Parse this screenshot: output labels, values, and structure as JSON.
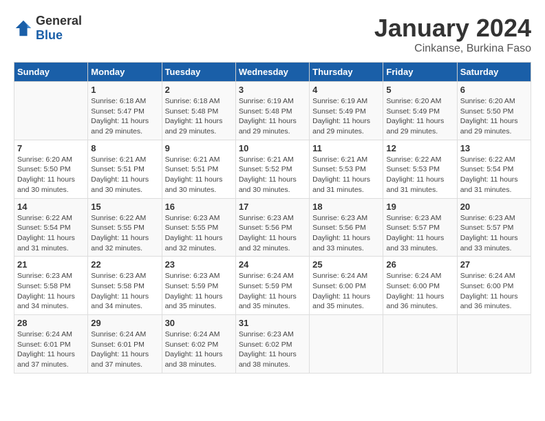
{
  "header": {
    "logo_general": "General",
    "logo_blue": "Blue",
    "month": "January 2024",
    "location": "Cinkanse, Burkina Faso"
  },
  "weekdays": [
    "Sunday",
    "Monday",
    "Tuesday",
    "Wednesday",
    "Thursday",
    "Friday",
    "Saturday"
  ],
  "weeks": [
    [
      {
        "day": "",
        "sunrise": "",
        "sunset": "",
        "daylight": ""
      },
      {
        "day": "1",
        "sunrise": "Sunrise: 6:18 AM",
        "sunset": "Sunset: 5:47 PM",
        "daylight": "Daylight: 11 hours and 29 minutes."
      },
      {
        "day": "2",
        "sunrise": "Sunrise: 6:18 AM",
        "sunset": "Sunset: 5:48 PM",
        "daylight": "Daylight: 11 hours and 29 minutes."
      },
      {
        "day": "3",
        "sunrise": "Sunrise: 6:19 AM",
        "sunset": "Sunset: 5:48 PM",
        "daylight": "Daylight: 11 hours and 29 minutes."
      },
      {
        "day": "4",
        "sunrise": "Sunrise: 6:19 AM",
        "sunset": "Sunset: 5:49 PM",
        "daylight": "Daylight: 11 hours and 29 minutes."
      },
      {
        "day": "5",
        "sunrise": "Sunrise: 6:20 AM",
        "sunset": "Sunset: 5:49 PM",
        "daylight": "Daylight: 11 hours and 29 minutes."
      },
      {
        "day": "6",
        "sunrise": "Sunrise: 6:20 AM",
        "sunset": "Sunset: 5:50 PM",
        "daylight": "Daylight: 11 hours and 29 minutes."
      }
    ],
    [
      {
        "day": "7",
        "sunrise": "Sunrise: 6:20 AM",
        "sunset": "Sunset: 5:50 PM",
        "daylight": "Daylight: 11 hours and 30 minutes."
      },
      {
        "day": "8",
        "sunrise": "Sunrise: 6:21 AM",
        "sunset": "Sunset: 5:51 PM",
        "daylight": "Daylight: 11 hours and 30 minutes."
      },
      {
        "day": "9",
        "sunrise": "Sunrise: 6:21 AM",
        "sunset": "Sunset: 5:51 PM",
        "daylight": "Daylight: 11 hours and 30 minutes."
      },
      {
        "day": "10",
        "sunrise": "Sunrise: 6:21 AM",
        "sunset": "Sunset: 5:52 PM",
        "daylight": "Daylight: 11 hours and 30 minutes."
      },
      {
        "day": "11",
        "sunrise": "Sunrise: 6:21 AM",
        "sunset": "Sunset: 5:53 PM",
        "daylight": "Daylight: 11 hours and 31 minutes."
      },
      {
        "day": "12",
        "sunrise": "Sunrise: 6:22 AM",
        "sunset": "Sunset: 5:53 PM",
        "daylight": "Daylight: 11 hours and 31 minutes."
      },
      {
        "day": "13",
        "sunrise": "Sunrise: 6:22 AM",
        "sunset": "Sunset: 5:54 PM",
        "daylight": "Daylight: 11 hours and 31 minutes."
      }
    ],
    [
      {
        "day": "14",
        "sunrise": "Sunrise: 6:22 AM",
        "sunset": "Sunset: 5:54 PM",
        "daylight": "Daylight: 11 hours and 31 minutes."
      },
      {
        "day": "15",
        "sunrise": "Sunrise: 6:22 AM",
        "sunset": "Sunset: 5:55 PM",
        "daylight": "Daylight: 11 hours and 32 minutes."
      },
      {
        "day": "16",
        "sunrise": "Sunrise: 6:23 AM",
        "sunset": "Sunset: 5:55 PM",
        "daylight": "Daylight: 11 hours and 32 minutes."
      },
      {
        "day": "17",
        "sunrise": "Sunrise: 6:23 AM",
        "sunset": "Sunset: 5:56 PM",
        "daylight": "Daylight: 11 hours and 32 minutes."
      },
      {
        "day": "18",
        "sunrise": "Sunrise: 6:23 AM",
        "sunset": "Sunset: 5:56 PM",
        "daylight": "Daylight: 11 hours and 33 minutes."
      },
      {
        "day": "19",
        "sunrise": "Sunrise: 6:23 AM",
        "sunset": "Sunset: 5:57 PM",
        "daylight": "Daylight: 11 hours and 33 minutes."
      },
      {
        "day": "20",
        "sunrise": "Sunrise: 6:23 AM",
        "sunset": "Sunset: 5:57 PM",
        "daylight": "Daylight: 11 hours and 33 minutes."
      }
    ],
    [
      {
        "day": "21",
        "sunrise": "Sunrise: 6:23 AM",
        "sunset": "Sunset: 5:58 PM",
        "daylight": "Daylight: 11 hours and 34 minutes."
      },
      {
        "day": "22",
        "sunrise": "Sunrise: 6:23 AM",
        "sunset": "Sunset: 5:58 PM",
        "daylight": "Daylight: 11 hours and 34 minutes."
      },
      {
        "day": "23",
        "sunrise": "Sunrise: 6:23 AM",
        "sunset": "Sunset: 5:59 PM",
        "daylight": "Daylight: 11 hours and 35 minutes."
      },
      {
        "day": "24",
        "sunrise": "Sunrise: 6:24 AM",
        "sunset": "Sunset: 5:59 PM",
        "daylight": "Daylight: 11 hours and 35 minutes."
      },
      {
        "day": "25",
        "sunrise": "Sunrise: 6:24 AM",
        "sunset": "Sunset: 6:00 PM",
        "daylight": "Daylight: 11 hours and 35 minutes."
      },
      {
        "day": "26",
        "sunrise": "Sunrise: 6:24 AM",
        "sunset": "Sunset: 6:00 PM",
        "daylight": "Daylight: 11 hours and 36 minutes."
      },
      {
        "day": "27",
        "sunrise": "Sunrise: 6:24 AM",
        "sunset": "Sunset: 6:00 PM",
        "daylight": "Daylight: 11 hours and 36 minutes."
      }
    ],
    [
      {
        "day": "28",
        "sunrise": "Sunrise: 6:24 AM",
        "sunset": "Sunset: 6:01 PM",
        "daylight": "Daylight: 11 hours and 37 minutes."
      },
      {
        "day": "29",
        "sunrise": "Sunrise: 6:24 AM",
        "sunset": "Sunset: 6:01 PM",
        "daylight": "Daylight: 11 hours and 37 minutes."
      },
      {
        "day": "30",
        "sunrise": "Sunrise: 6:24 AM",
        "sunset": "Sunset: 6:02 PM",
        "daylight": "Daylight: 11 hours and 38 minutes."
      },
      {
        "day": "31",
        "sunrise": "Sunrise: 6:23 AM",
        "sunset": "Sunset: 6:02 PM",
        "daylight": "Daylight: 11 hours and 38 minutes."
      },
      {
        "day": "",
        "sunrise": "",
        "sunset": "",
        "daylight": ""
      },
      {
        "day": "",
        "sunrise": "",
        "sunset": "",
        "daylight": ""
      },
      {
        "day": "",
        "sunrise": "",
        "sunset": "",
        "daylight": ""
      }
    ]
  ]
}
